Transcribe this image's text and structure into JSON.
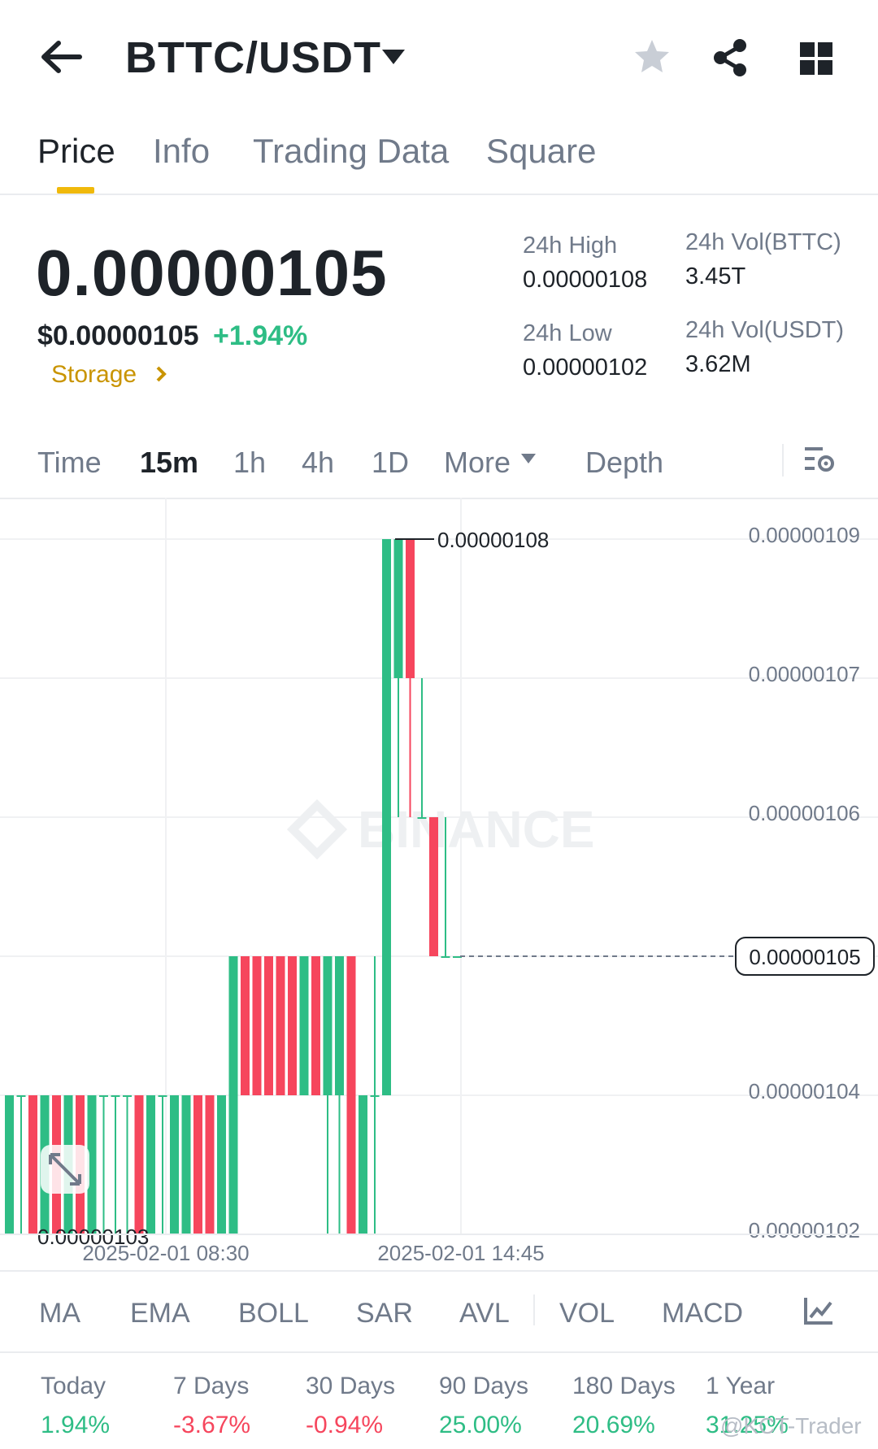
{
  "header": {
    "back_icon": "arrow-left-icon",
    "pair": "BTTC/USDT",
    "caret_icon": "caret-down-icon",
    "star_icon": "star-icon",
    "share_icon": "share-icon",
    "grid_icon": "grid-icon"
  },
  "tabs": [
    {
      "label": "Price",
      "active": true
    },
    {
      "label": "Info"
    },
    {
      "label": "Trading Data"
    },
    {
      "label": "Square"
    }
  ],
  "price": {
    "last": "0.00000105",
    "usd": "$0.00000105",
    "change": "+1.94%",
    "tag": "Storage"
  },
  "stats": {
    "high_label": "24h High",
    "high": "0.00000108",
    "low_label": "24h Low",
    "low": "0.00000102",
    "vol_base_label": "24h Vol(BTTC)",
    "vol_base": "3.45T",
    "vol_quote_label": "24h Vol(USDT)",
    "vol_quote": "3.62M"
  },
  "intervals": {
    "time": "Time",
    "m15": "15m",
    "h1": "1h",
    "h4": "4h",
    "d1": "1D",
    "more": "More",
    "depth": "Depth",
    "active": "15m",
    "settings_icon": "chart-settings-icon"
  },
  "chart_data": {
    "type": "candlestick",
    "y_ticks": [
      "0.00000109",
      "0.00000107",
      "0.00000106",
      "0.00000105",
      "0.00000104",
      "0.00000102"
    ],
    "x_ticks": [
      "2025-02-01 08:30",
      "2025-02-01 14:45"
    ],
    "high_marker": "0.00000108",
    "low_marker": "0.00000103",
    "current_price": "0.00000105",
    "watermark": "BINANCE",
    "colors": {
      "up": "#2ebd85",
      "down": "#f6465d"
    },
    "candles": [
      {
        "o": 1.03,
        "h": 1.04,
        "l": 1.03,
        "c": 1.04
      },
      {
        "o": 1.04,
        "h": 1.04,
        "l": 1.03,
        "c": 1.04
      },
      {
        "o": 1.04,
        "h": 1.04,
        "l": 1.03,
        "c": 1.03
      },
      {
        "o": 1.03,
        "h": 1.04,
        "l": 1.03,
        "c": 1.04
      },
      {
        "o": 1.04,
        "h": 1.04,
        "l": 1.03,
        "c": 1.03
      },
      {
        "o": 1.03,
        "h": 1.04,
        "l": 1.03,
        "c": 1.04
      },
      {
        "o": 1.04,
        "h": 1.04,
        "l": 1.03,
        "c": 1.03
      },
      {
        "o": 1.03,
        "h": 1.04,
        "l": 1.03,
        "c": 1.04
      },
      {
        "o": 1.04,
        "h": 1.04,
        "l": 1.03,
        "c": 1.04
      },
      {
        "o": 1.04,
        "h": 1.04,
        "l": 1.03,
        "c": 1.04
      },
      {
        "o": 1.04,
        "h": 1.04,
        "l": 1.03,
        "c": 1.04
      },
      {
        "o": 1.04,
        "h": 1.04,
        "l": 1.03,
        "c": 1.03
      },
      {
        "o": 1.03,
        "h": 1.04,
        "l": 1.03,
        "c": 1.04
      },
      {
        "o": 1.04,
        "h": 1.04,
        "l": 1.03,
        "c": 1.04
      },
      {
        "o": 1.03,
        "h": 1.04,
        "l": 1.03,
        "c": 1.04
      },
      {
        "o": 1.03,
        "h": 1.04,
        "l": 1.03,
        "c": 1.04
      },
      {
        "o": 1.04,
        "h": 1.04,
        "l": 1.03,
        "c": 1.03
      },
      {
        "o": 1.04,
        "h": 1.04,
        "l": 1.03,
        "c": 1.03
      },
      {
        "o": 1.03,
        "h": 1.04,
        "l": 1.03,
        "c": 1.04
      },
      {
        "o": 1.03,
        "h": 1.05,
        "l": 1.03,
        "c": 1.05
      },
      {
        "o": 1.05,
        "h": 1.05,
        "l": 1.04,
        "c": 1.04
      },
      {
        "o": 1.05,
        "h": 1.05,
        "l": 1.04,
        "c": 1.04
      },
      {
        "o": 1.05,
        "h": 1.05,
        "l": 1.04,
        "c": 1.04
      },
      {
        "o": 1.05,
        "h": 1.05,
        "l": 1.04,
        "c": 1.04
      },
      {
        "o": 1.05,
        "h": 1.05,
        "l": 1.04,
        "c": 1.04
      },
      {
        "o": 1.04,
        "h": 1.05,
        "l": 1.04,
        "c": 1.05
      },
      {
        "o": 1.05,
        "h": 1.05,
        "l": 1.04,
        "c": 1.04
      },
      {
        "o": 1.04,
        "h": 1.05,
        "l": 1.03,
        "c": 1.05
      },
      {
        "o": 1.04,
        "h": 1.05,
        "l": 1.03,
        "c": 1.05
      },
      {
        "o": 1.05,
        "h": 1.05,
        "l": 1.03,
        "c": 1.03
      },
      {
        "o": 1.03,
        "h": 1.04,
        "l": 1.03,
        "c": 1.04
      },
      {
        "o": 1.04,
        "h": 1.05,
        "l": 1.03,
        "c": 1.04
      },
      {
        "o": 1.04,
        "h": 1.05,
        "l": 1.04,
        "c": 1.08
      },
      {
        "o": 1.07,
        "h": 1.08,
        "l": 1.06,
        "c": 1.08
      },
      {
        "o": 1.08,
        "h": 1.08,
        "l": 1.06,
        "c": 1.07
      },
      {
        "o": 1.06,
        "h": 1.07,
        "l": 1.06,
        "c": 1.06
      },
      {
        "o": 1.06,
        "h": 1.06,
        "l": 1.05,
        "c": 1.05
      },
      {
        "o": 1.05,
        "h": 1.06,
        "l": 1.05,
        "c": 1.05
      },
      {
        "o": 1.05,
        "h": 1.05,
        "l": 1.05,
        "c": 1.05
      }
    ]
  },
  "indicators": [
    "MA",
    "EMA",
    "BOLL",
    "SAR",
    "AVL",
    "VOL",
    "MACD"
  ],
  "indicator_icon": "chart-line-icon",
  "performance": [
    {
      "label": "Today",
      "value": "1.94%",
      "dir": "up"
    },
    {
      "label": "7 Days",
      "value": "-3.67%",
      "dir": "down"
    },
    {
      "label": "30 Days",
      "value": "-0.94%",
      "dir": "down"
    },
    {
      "label": "90 Days",
      "value": "25.00%",
      "dir": "up"
    },
    {
      "label": "180 Days",
      "value": "20.69%",
      "dir": "up"
    },
    {
      "label": "1 Year",
      "value": "31.25%",
      "dir": "up"
    }
  ],
  "watermark_corner": "@KCT-Trader"
}
